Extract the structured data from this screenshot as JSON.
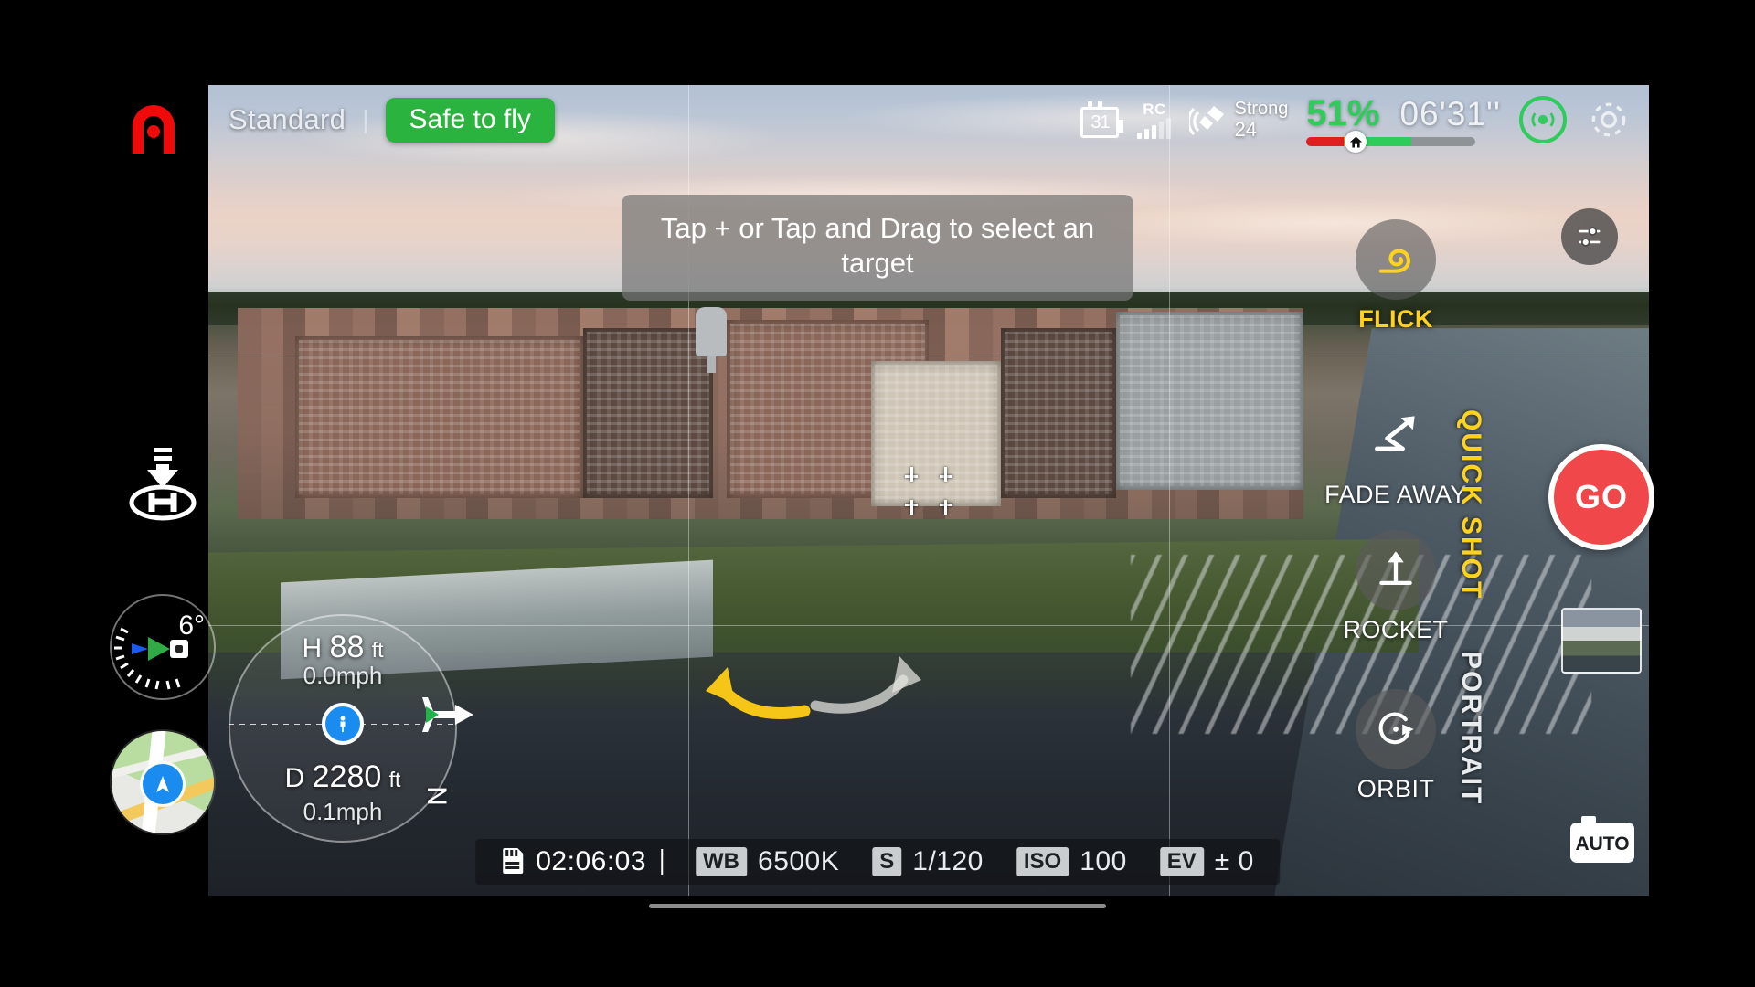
{
  "app": {
    "logo": "autel-a-logo",
    "flight_mode": "Standard",
    "separator": "|",
    "status_pill": "Safe to fly",
    "accent_yellow": "#ffd21e",
    "accent_green": "#2bb33f",
    "accent_red": "#f0484a",
    "battery_green": "#2ecc5a"
  },
  "statusbar": {
    "sd_card": {
      "icon": "sd-card-icon",
      "value": "31"
    },
    "rc_signal": {
      "label": "RC",
      "icon": "rc-signal-bars-icon",
      "bars_filled": 3,
      "bars_total": 5
    },
    "gnss": {
      "icon": "satellite-icon",
      "strength": "Strong",
      "count": "24"
    },
    "battery": {
      "percent": "51%",
      "level": 51
    },
    "flight_time": "06'31''",
    "home_marker_icon": "home-icon",
    "beacon_button": "beacon-icon",
    "settings_button": "gear-icon"
  },
  "tip_banner": "Tap + or Tap and Drag to select an target",
  "left_rail": {
    "return_to_home": {
      "icon": "return-to-home-icon",
      "label": "RTH"
    },
    "gimbal": {
      "icon": "gimbal-pitch-dial-icon",
      "angle": "6°"
    },
    "map": {
      "icon": "map-thumbnail",
      "nav_icon": "navigation-arrow-icon"
    }
  },
  "telemetry": {
    "height_label": "H",
    "height_value": "88",
    "height_unit": "ft",
    "vertical_speed": "0.0mph",
    "distance_label": "D",
    "distance_value": "2280",
    "distance_unit": "ft",
    "horizontal_speed": "0.1mph",
    "pilot_icon": "pilot-position-icon",
    "aircraft_icon": "aircraft-icon",
    "north_label": "N"
  },
  "quickshot": {
    "category_active": "QUICK SHOT",
    "category_next": "PORTRAIT",
    "items": [
      {
        "label": "FLICK",
        "icon": "flick-spiral-icon",
        "active": true
      },
      {
        "label": "FADE AWAY",
        "icon": "fade-away-arrow-icon",
        "active": false
      },
      {
        "label": "ROCKET",
        "icon": "rocket-up-arrow-icon",
        "active": false
      },
      {
        "label": "ORBIT",
        "icon": "orbit-circle-icon",
        "active": false
      }
    ]
  },
  "right_controls": {
    "tune_button": {
      "icon": "sliders-icon"
    },
    "go_button": {
      "label": "GO"
    },
    "thumbnail": {
      "icon": "media-thumbnail"
    },
    "auto_camera": {
      "label": "AUTO",
      "icon": "camera-icon"
    }
  },
  "camera_bar": {
    "sd_icon": "sd-card-icon",
    "record_time": "02:06:03",
    "settings": [
      {
        "chip": "WB",
        "value": "6500K"
      },
      {
        "chip": "S",
        "value": "1/120"
      },
      {
        "chip": "ISO",
        "value": "100"
      },
      {
        "chip": "EV",
        "value": "± 0"
      }
    ]
  }
}
